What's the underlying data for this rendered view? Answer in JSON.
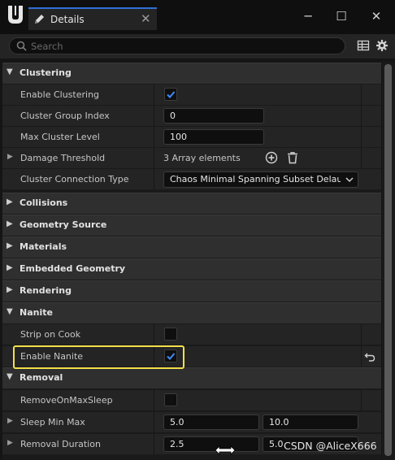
{
  "window": {
    "tab_title": "Details",
    "tab_close_glyph": "✕",
    "minimize_glyph": "─",
    "maximize_glyph": "☐",
    "close_glyph": "✕"
  },
  "search": {
    "placeholder": "Search"
  },
  "icons": {
    "logo": "unreal-logo-icon",
    "tab": "pencil-icon",
    "table_view": "table-view-icon",
    "settings": "gear-icon",
    "add": "add-circle-icon",
    "delete": "trash-icon",
    "reset": "reset-to-default-icon",
    "collapse": "collapse-arrow-icon",
    "expand": "expand-arrow-icon"
  },
  "colors": {
    "accent": "#2f6fd6",
    "highlight": "#f2e04a",
    "check": "#3d8bff"
  },
  "categories": {
    "clustering": "Clustering",
    "collisions": "Collisions",
    "geometry_source": "Geometry Source",
    "materials": "Materials",
    "embedded_geometry": "Embedded Geometry",
    "rendering": "Rendering",
    "nanite": "Nanite",
    "removal": "Removal"
  },
  "properties": {
    "enable_clustering": {
      "label": "Enable Clustering",
      "checked": true
    },
    "cluster_group_index": {
      "label": "Cluster Group Index",
      "value": "0"
    },
    "max_cluster_level": {
      "label": "Max Cluster Level",
      "value": "100"
    },
    "damage_threshold": {
      "label": "Damage Threshold",
      "value": "3 Array elements"
    },
    "cluster_connection_type": {
      "label": "Cluster Connection Type",
      "value": "Chaos Minimal Spanning Subset Delauna"
    },
    "strip_on_cook": {
      "label": "Strip on Cook",
      "checked": false
    },
    "enable_nanite": {
      "label": "Enable Nanite",
      "checked": true
    },
    "remove_on_max_sleep": {
      "label": "RemoveOnMaxSleep",
      "checked": false
    },
    "sleep_min_max": {
      "label": "Sleep Min Max",
      "min": "5.0",
      "max": "10.0"
    },
    "removal_duration": {
      "label": "Removal Duration",
      "min": "2.5",
      "max": "5.0"
    }
  },
  "watermark": "CSDN @AliceX666"
}
